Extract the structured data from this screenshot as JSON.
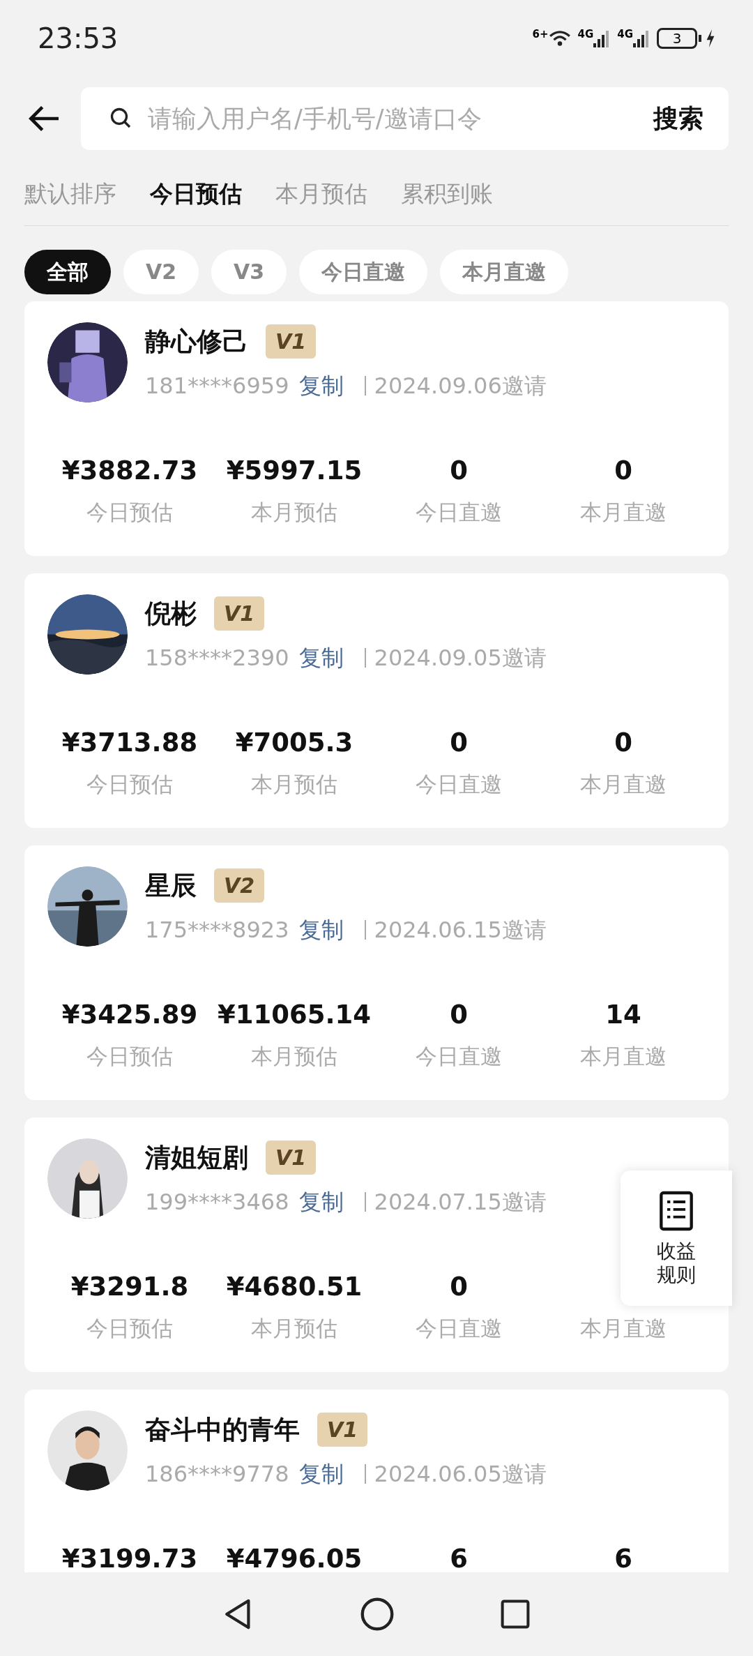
{
  "status_bar": {
    "time": "23:53",
    "wifi_label": "6+",
    "networks": [
      "4G",
      "4G"
    ],
    "battery": "3"
  },
  "search": {
    "placeholder": "请输入用户名/手机号/邀请口令",
    "button": "搜索"
  },
  "sort_tabs": [
    {
      "label": "默认排序",
      "selected": false
    },
    {
      "label": "今日预估",
      "selected": true
    },
    {
      "label": "本月预估",
      "selected": false
    },
    {
      "label": "累积到账",
      "selected": false
    }
  ],
  "filters": [
    {
      "label": "全部",
      "selected": true
    },
    {
      "label": "V2",
      "selected": false
    },
    {
      "label": "V3",
      "selected": false
    },
    {
      "label": "今日直邀",
      "selected": false
    },
    {
      "label": "本月直邀",
      "selected": false
    }
  ],
  "members": [
    {
      "name": "静心修己",
      "level_badge": "V1",
      "phone": "181****6959",
      "copy": "复制",
      "invited": "2024.09.06邀请",
      "stats": [
        {
          "value": "¥3882.73",
          "label": "今日预估"
        },
        {
          "value": "¥5997.15",
          "label": "本月预估"
        },
        {
          "value": "0",
          "label": "今日直邀"
        },
        {
          "value": "0",
          "label": "本月直邀"
        }
      ]
    },
    {
      "name": "倪彬",
      "level_badge": "V1",
      "phone": "158****2390",
      "copy": "复制",
      "invited": "2024.09.05邀请",
      "stats": [
        {
          "value": "¥3713.88",
          "label": "今日预估"
        },
        {
          "value": "¥7005.3",
          "label": "本月预估"
        },
        {
          "value": "0",
          "label": "今日直邀"
        },
        {
          "value": "0",
          "label": "本月直邀"
        }
      ]
    },
    {
      "name": "星辰",
      "level_badge": "V2",
      "phone": "175****8923",
      "copy": "复制",
      "invited": "2024.06.15邀请",
      "stats": [
        {
          "value": "¥3425.89",
          "label": "今日预估"
        },
        {
          "value": "¥11065.14",
          "label": "本月预估"
        },
        {
          "value": "0",
          "label": "今日直邀"
        },
        {
          "value": "14",
          "label": "本月直邀"
        }
      ]
    },
    {
      "name": "清姐短剧",
      "level_badge": "V1",
      "phone": "199****3468",
      "copy": "复制",
      "invited": "2024.07.15邀请",
      "stats": [
        {
          "value": "¥3291.8",
          "label": "今日预估"
        },
        {
          "value": "¥4680.51",
          "label": "本月预估"
        },
        {
          "value": "0",
          "label": "今日直邀"
        },
        {
          "label": "本月直邀"
        }
      ]
    },
    {
      "name": "奋斗中的青年",
      "level_badge": "V1",
      "phone": "186****9778",
      "copy": "复制",
      "invited": "2024.06.05邀请",
      "stats": [
        {
          "value": "¥3199.73"
        },
        {
          "value": "¥4796.05"
        },
        {
          "value": "6"
        },
        {
          "value": "6"
        }
      ]
    }
  ],
  "floating_button": {
    "label_lines": [
      "收益",
      "规则"
    ]
  }
}
